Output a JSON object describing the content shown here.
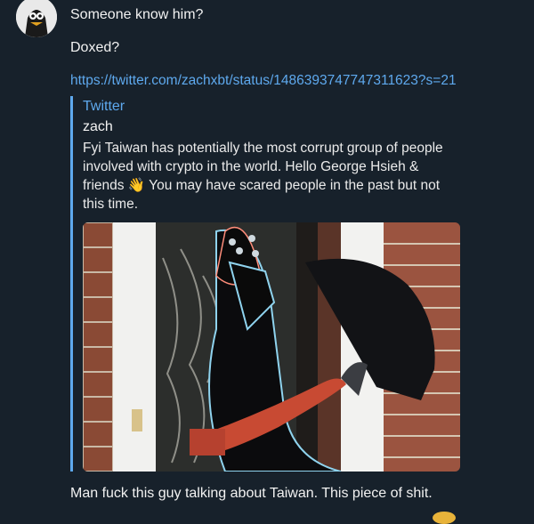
{
  "messages": {
    "line1": "Someone know him?",
    "line2": "Doxed?",
    "link": "https://twitter.com/zachxbt/status/1486393747747311623?s=21",
    "caption": "Man fuck this guy talking about Taiwan. This piece of shit."
  },
  "preview": {
    "site": "Twitter",
    "title": "zach",
    "desc_before": "Fyi Taiwan has potentially the most corrupt group of people involved with crypto in the world. Hello George Hsieh & friends ",
    "emoji": "👋",
    "desc_after": " You may have scared people in the past but not this time."
  },
  "colors": {
    "background": "#17212b",
    "link": "#5ea9ee",
    "text": "#f2f2f2"
  }
}
